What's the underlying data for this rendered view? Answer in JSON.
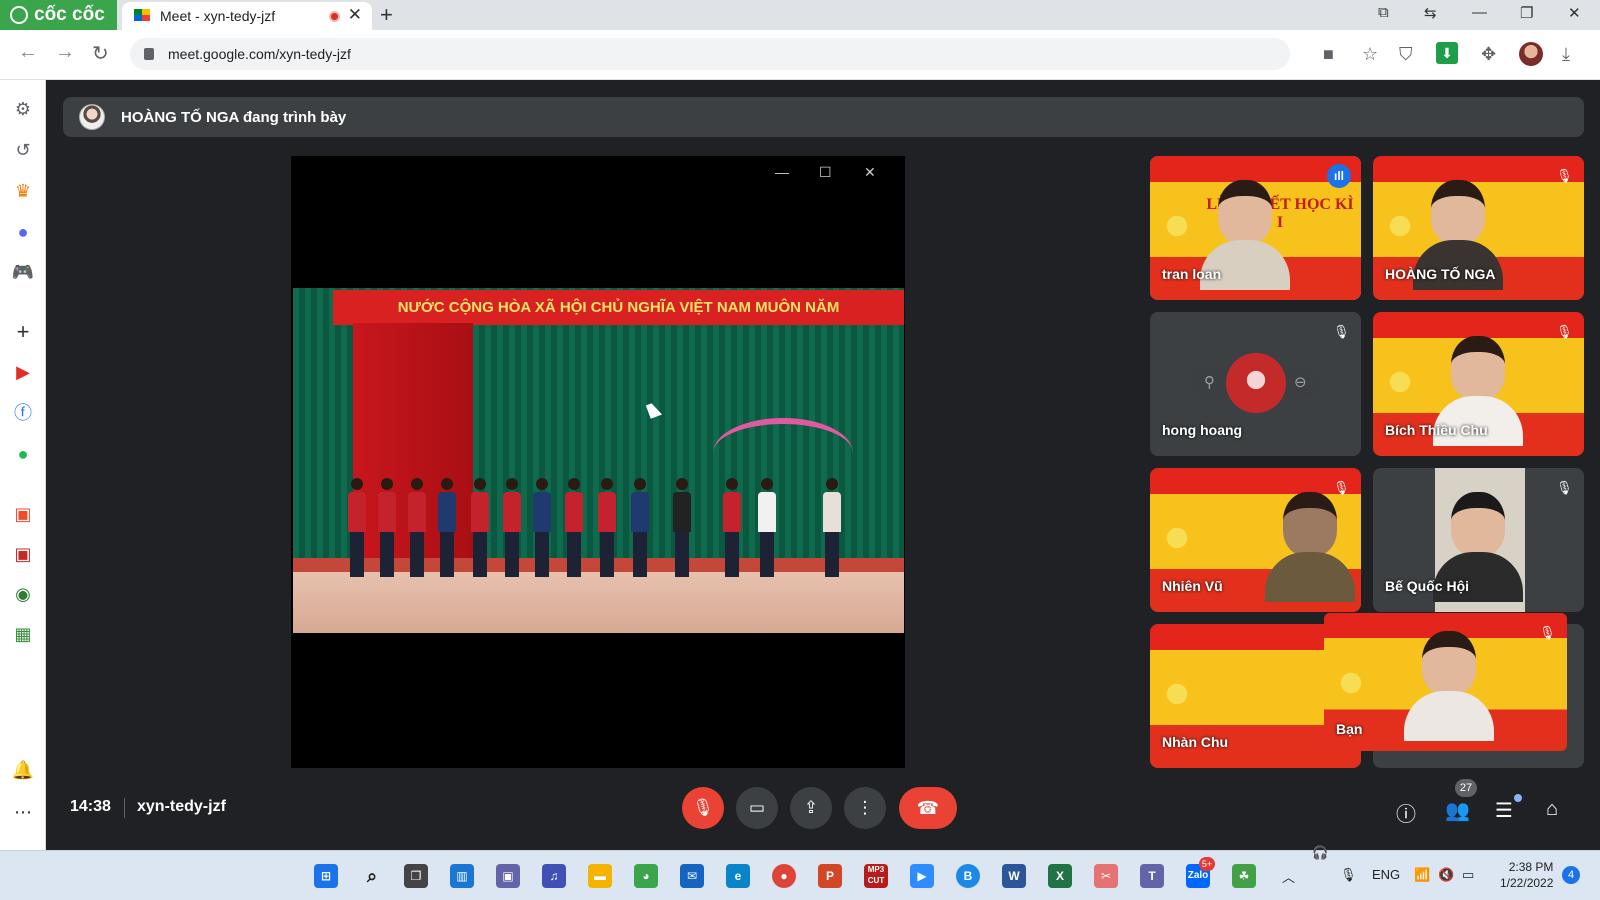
{
  "browser": {
    "brand": "cốc cốc",
    "tab_title": "Meet - xyn-tedy-jzf",
    "url": "meet.google.com/xyn-tedy-jzf"
  },
  "meet": {
    "presenter_banner": "HOÀNG TỐ NGA đang trình bày",
    "slide_banner": "NƯỚC CỘNG HÒA XÃ HỘI CHỦ NGHĨA VIỆT NAM MUÔN NĂM",
    "tile_bg_text": "LỄ SƠ KẾT HỌC KÌ I",
    "participants": [
      {
        "name": "tran loan"
      },
      {
        "name": "HOÀNG TỐ NGA"
      },
      {
        "name": "hong hoang"
      },
      {
        "name": "Bích Thiều Chu"
      },
      {
        "name": "Nhiên Vũ"
      },
      {
        "name": "Bế Quốc Hội"
      },
      {
        "name": "Nhàn Chu"
      },
      {
        "name": "Bạn"
      }
    ],
    "time": "14:38",
    "meeting_code": "xyn-tedy-jzf",
    "people_count": "27"
  },
  "taskbar": {
    "language": "ENG",
    "time": "2:38 PM",
    "date": "1/22/2022",
    "notifications": "4",
    "zalo_badge": "5+",
    "mp3cut_label": "MP3 CUT"
  },
  "colors": {
    "meet_bg": "#202124",
    "hangup": "#ea4335",
    "brand_green": "#3aa54b",
    "active_outline": "#8ab4f8"
  }
}
